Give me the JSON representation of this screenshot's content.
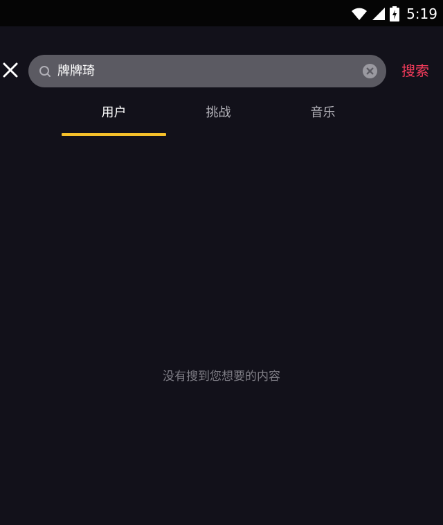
{
  "status_bar": {
    "time": "5:19",
    "icons": [
      "wifi-icon",
      "signal-icon",
      "battery-icon"
    ]
  },
  "header": {
    "close_icon": "close-icon",
    "search": {
      "value": "牌牌琦",
      "placeholder": "",
      "search_icon": "search-icon",
      "clear_icon": "clear-icon"
    },
    "submit_label": "搜索"
  },
  "tabs": [
    {
      "label": "用户",
      "active": true
    },
    {
      "label": "挑战",
      "active": false
    },
    {
      "label": "音乐",
      "active": false
    }
  ],
  "empty_state": {
    "message": "没有搜到您想要的内容"
  },
  "colors": {
    "background": "#12111a",
    "accent": "#f23b5b",
    "tab_indicator": "#f5c02a",
    "search_box": "#5b5a62"
  }
}
